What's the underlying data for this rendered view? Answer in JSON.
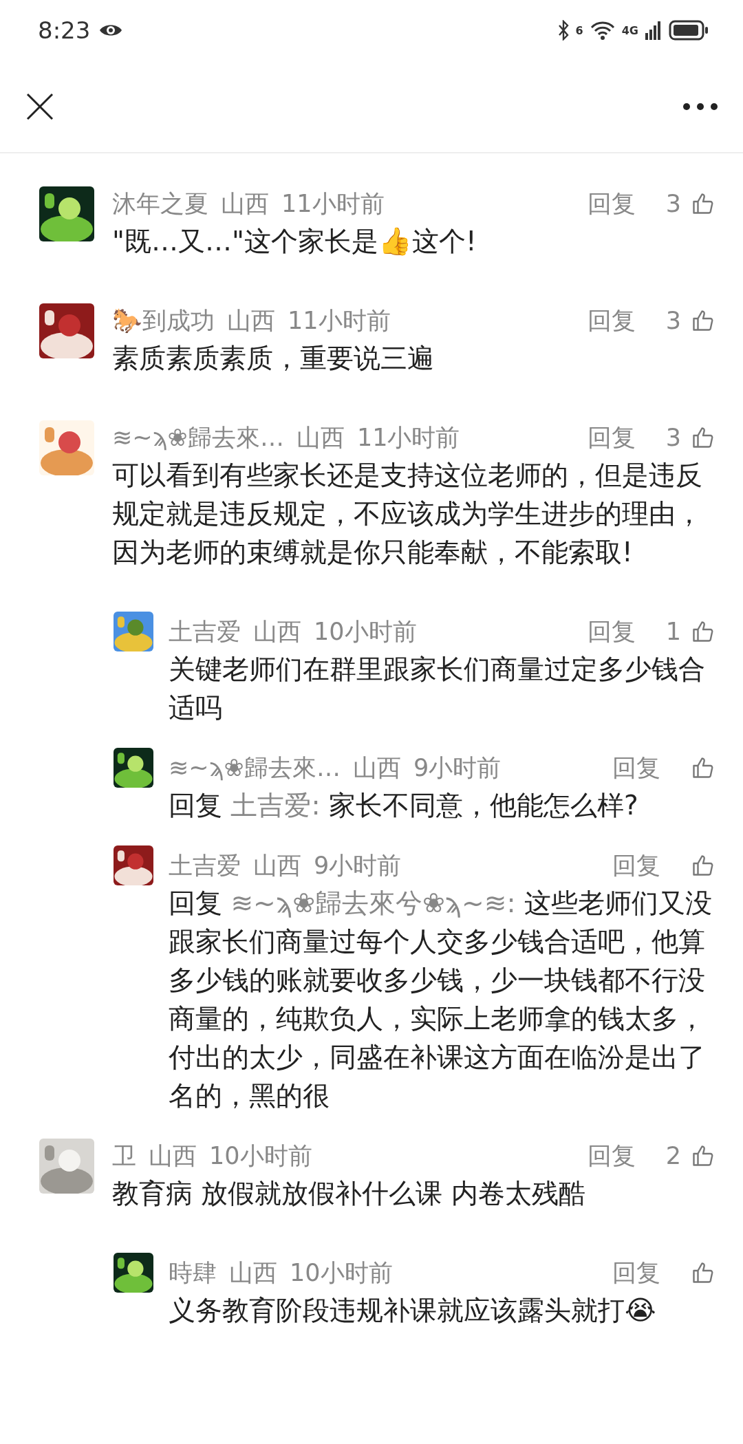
{
  "status_bar": {
    "time": "8:23",
    "wifi_badge": "6",
    "network": "4G"
  },
  "comments": [
    {
      "name": "沐年之夏",
      "location": "山西",
      "time": "11小时前",
      "reply_button": "回复",
      "like_count": "3",
      "text": "\"既…又…\"这个家长是👍这个!"
    },
    {
      "name": "🐎到成功",
      "location": "山西",
      "time": "11小时前",
      "reply_button": "回复",
      "like_count": "3",
      "text": "素质素质素质，重要说三遍"
    },
    {
      "name": "≋~ϡ❀歸去來…",
      "location": "山西",
      "time": "11小时前",
      "reply_button": "回复",
      "like_count": "3",
      "text": "可以看到有些家长还是支持这位老师的，但是违反规定就是违反规定，不应该成为学生进步的理由，因为老师的束缚就是你只能奉献，不能索取!",
      "replies": [
        {
          "name": "土吉爱",
          "location": "山西",
          "time": "10小时前",
          "reply_button": "回复",
          "like_count": "1",
          "text": "关键老师们在群里跟家长们商量过定多少钱合适吗"
        },
        {
          "name": "≋~ϡ❀歸去來…",
          "location": "山西",
          "time": "9小时前",
          "reply_button": "回复",
          "reply_label": "回复",
          "reply_to": "土吉爱:",
          "text": "家长不同意，他能怎么样?"
        },
        {
          "name": "土吉爱",
          "location": "山西",
          "time": "9小时前",
          "reply_button": "回复",
          "reply_label": "回复",
          "reply_to": "≋~ϡ❀歸去來兮❀ϡ~≋:",
          "text": "这些老师们又没跟家长们商量过每个人交多少钱合适吧，他算多少钱的账就要收多少钱，少一块钱都不行没商量的，纯欺负人，实际上老师拿的钱太多，付出的太少，同盛在补课这方面在临汾是出了名的，黑的很"
        }
      ]
    },
    {
      "name": "卫",
      "location": "山西",
      "time": "10小时前",
      "reply_button": "回复",
      "like_count": "2",
      "text": "教育病  放假就放假补什么课 内卷太残酷",
      "replies": [
        {
          "name": "時肆",
          "location": "山西",
          "time": "10小时前",
          "reply_button": "回复",
          "text": "义务教育阶段违规补课就应该露头就打😭"
        }
      ]
    }
  ]
}
